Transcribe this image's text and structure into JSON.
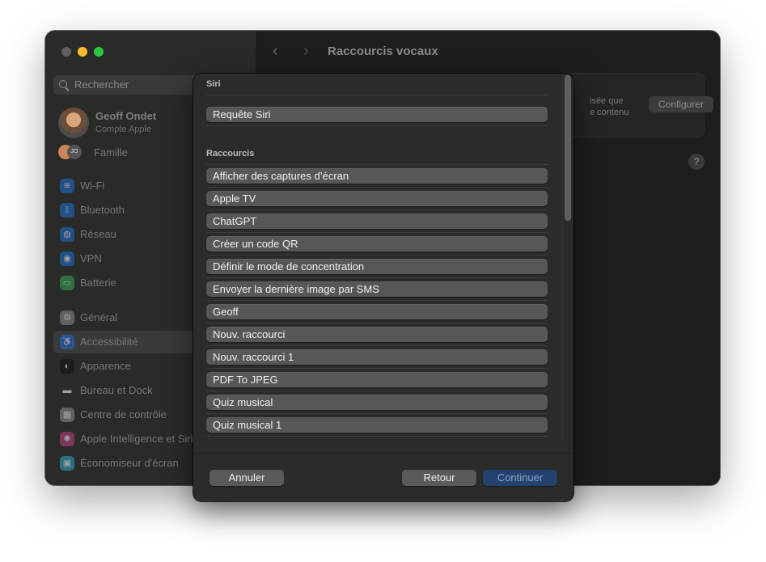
{
  "sidebar": {
    "search_placeholder": "Rechercher",
    "profile": {
      "name": "Geoff Ondet",
      "subtitle": "Compte Apple"
    },
    "family": {
      "initials": "JO",
      "label": "Famille"
    },
    "items": [
      {
        "label": "Wi-Fi",
        "icon": "wifi-icon",
        "color": "#1e6fd9",
        "glyph": "≋"
      },
      {
        "label": "Bluetooth",
        "icon": "bluetooth-icon",
        "color": "#1e6fd9",
        "glyph": "ᛒ"
      },
      {
        "label": "Réseau",
        "icon": "globe-icon",
        "color": "#1e6fd9",
        "glyph": "◍"
      },
      {
        "label": "VPN",
        "icon": "vpn-icon",
        "color": "#1e6fd9",
        "glyph": "◉"
      },
      {
        "label": "Batterie",
        "icon": "battery-icon",
        "color": "#34a853",
        "glyph": "▭"
      },
      {
        "label": "Général",
        "icon": "gear-icon",
        "color": "#8e8e93",
        "glyph": "⚙"
      },
      {
        "label": "Accessibilité",
        "icon": "accessibility-icon",
        "color": "#1e6fd9",
        "glyph": "♿"
      },
      {
        "label": "Apparence",
        "icon": "appearance-icon",
        "color": "#111111",
        "glyph": "◐"
      },
      {
        "label": "Bureau et Dock",
        "icon": "dock-icon",
        "color": "#2c2c2e",
        "glyph": "▬"
      },
      {
        "label": "Centre de contrôle",
        "icon": "control-center-icon",
        "color": "#8e8e93",
        "glyph": "▦"
      },
      {
        "label": "Apple Intelligence et Siri",
        "icon": "siri-icon",
        "color": "#c2427a",
        "glyph": "✺"
      },
      {
        "label": "Économiseur d'écran",
        "icon": "screensaver-icon",
        "color": "#2aa6c9",
        "glyph": "▣"
      }
    ]
  },
  "content": {
    "title": "Raccourcis vocaux",
    "card_text_line1": "isée que",
    "card_text_line2": "e contenu",
    "configure_label": "Configurer",
    "help_label": "?"
  },
  "sheet": {
    "siri_section": "Siri",
    "siri_items": [
      "Requête Siri"
    ],
    "shortcuts_section": "Raccourcis",
    "shortcuts": [
      "Afficher des captures d’écran",
      "Apple TV",
      "ChatGPT",
      "Créer un code QR",
      "Définir le mode de concentration",
      "Envoyer la dernière image par SMS",
      "Geoff",
      "Nouv. raccourci",
      "Nouv. raccourci 1",
      "PDF To JPEG",
      "Quiz musical",
      "Quiz musical 1"
    ],
    "cancel_label": "Annuler",
    "back_label": "Retour",
    "continue_label": "Continuer"
  }
}
